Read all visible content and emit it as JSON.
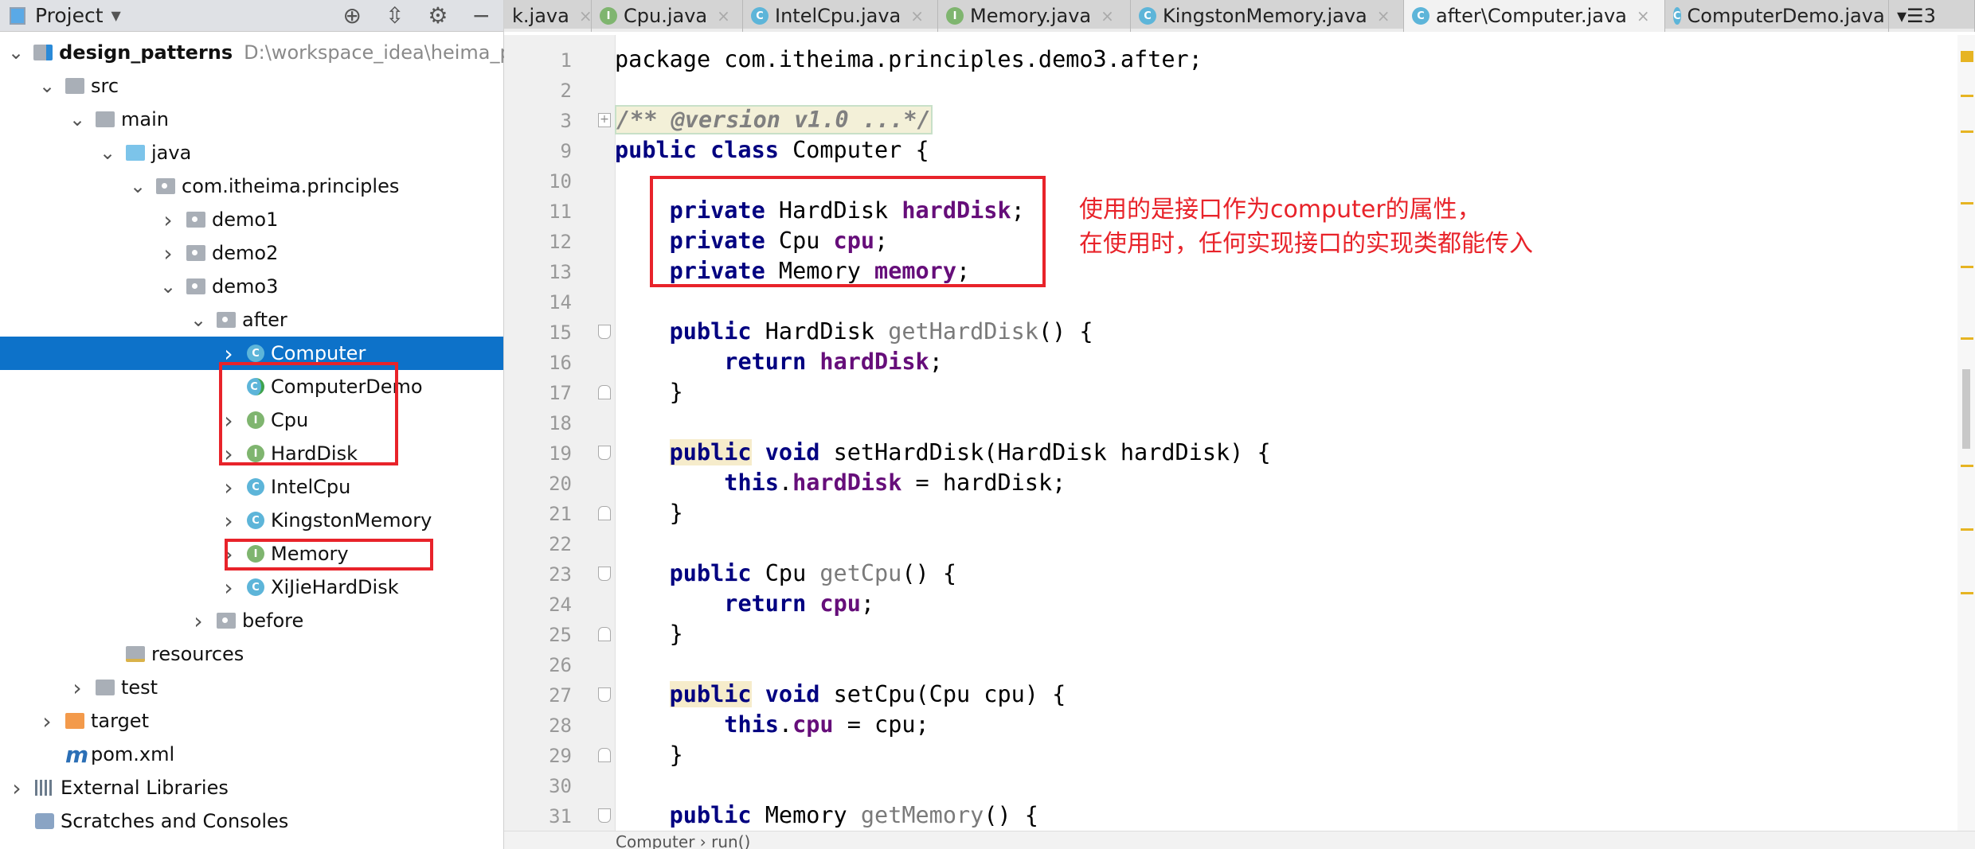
{
  "project_panel": {
    "title": "Project",
    "tree": [
      {
        "label": "design_patterns",
        "hint": "D:\\workspace_idea\\heima_pat",
        "level": 0,
        "icon": "module-folder",
        "expanded": true,
        "bold": true
      },
      {
        "label": "src",
        "level": 1,
        "icon": "folder",
        "expanded": true
      },
      {
        "label": "main",
        "level": 2,
        "icon": "folder",
        "expanded": true
      },
      {
        "label": "java",
        "level": 3,
        "icon": "source-folder",
        "expanded": true
      },
      {
        "label": "com.itheima.principles",
        "level": 4,
        "icon": "package",
        "expanded": true
      },
      {
        "label": "demo1",
        "level": 5,
        "icon": "package",
        "expanded": false
      },
      {
        "label": "demo2",
        "level": 5,
        "icon": "package",
        "expanded": false
      },
      {
        "label": "demo3",
        "level": 5,
        "icon": "package",
        "expanded": true
      },
      {
        "label": "after",
        "level": 6,
        "icon": "package",
        "expanded": true
      },
      {
        "label": "Computer",
        "level": 7,
        "icon": "class",
        "expanded": false,
        "selected": true
      },
      {
        "label": "ComputerDemo",
        "level": 7,
        "icon": "class-runnable"
      },
      {
        "label": "Cpu",
        "level": 7,
        "icon": "interface",
        "expanded": false
      },
      {
        "label": "HardDisk",
        "level": 7,
        "icon": "interface",
        "expanded": false
      },
      {
        "label": "IntelCpu",
        "level": 7,
        "icon": "class",
        "expanded": false
      },
      {
        "label": "KingstonMemory",
        "level": 7,
        "icon": "class",
        "expanded": false
      },
      {
        "label": "Memory",
        "level": 7,
        "icon": "interface",
        "expanded": false
      },
      {
        "label": "XiJieHardDisk",
        "level": 7,
        "icon": "class",
        "expanded": false
      },
      {
        "label": "before",
        "level": 6,
        "icon": "package",
        "expanded": false
      },
      {
        "label": "resources",
        "level": 3,
        "icon": "resources-folder"
      },
      {
        "label": "test",
        "level": 2,
        "icon": "folder",
        "expanded": false
      },
      {
        "label": "target",
        "level": 1,
        "icon": "excluded-folder",
        "expanded": false
      },
      {
        "label": "pom.xml",
        "level": 1,
        "icon": "maven-file"
      },
      {
        "label": "External Libraries",
        "level": 0,
        "icon": "library",
        "expanded": false
      },
      {
        "label": "Scratches and Consoles",
        "level": 0,
        "icon": "scratches"
      }
    ]
  },
  "tabs": [
    {
      "label": "k.java",
      "icon": "none"
    },
    {
      "label": "Cpu.java",
      "icon": "interface"
    },
    {
      "label": "IntelCpu.java",
      "icon": "class"
    },
    {
      "label": "Memory.java",
      "icon": "interface"
    },
    {
      "label": "KingstonMemory.java",
      "icon": "class"
    },
    {
      "label": "after\\Computer.java",
      "icon": "class",
      "active": true
    },
    {
      "label": "ComputerDemo.java",
      "icon": "class-runnable"
    }
  ],
  "tabs_overflow": "3",
  "code": [
    {
      "n": "1",
      "t": [
        [
          "package com.itheima.principles.demo3.after;",
          ""
        ]
      ]
    },
    {
      "n": "2",
      "t": []
    },
    {
      "n": "3",
      "fold": "plus",
      "t": [
        [
          "/** @version v1.0 ...*/",
          "cmt"
        ]
      ]
    },
    {
      "n": "9",
      "t": [
        [
          "public class",
          "kw"
        ],
        [
          " Computer {",
          ""
        ]
      ]
    },
    {
      "n": "10",
      "t": []
    },
    {
      "n": "11",
      "t": [
        [
          "    ",
          ""
        ],
        [
          "private",
          "kw"
        ],
        [
          " HardDisk ",
          ""
        ],
        [
          "hardDisk",
          "fld"
        ],
        [
          ";",
          ""
        ]
      ]
    },
    {
      "n": "12",
      "t": [
        [
          "    ",
          ""
        ],
        [
          "private",
          "kw"
        ],
        [
          " Cpu ",
          ""
        ],
        [
          "cpu",
          "fld"
        ],
        [
          ";",
          ""
        ]
      ]
    },
    {
      "n": "13",
      "t": [
        [
          "    ",
          ""
        ],
        [
          "private",
          "kw"
        ],
        [
          " Memory ",
          ""
        ],
        [
          "memory",
          "fld"
        ],
        [
          ";",
          ""
        ]
      ]
    },
    {
      "n": "14",
      "t": []
    },
    {
      "n": "15",
      "fold": "open",
      "t": [
        [
          "    ",
          ""
        ],
        [
          "public",
          "kw"
        ],
        [
          " HardDisk ",
          ""
        ],
        [
          "getHardDisk",
          "mth"
        ],
        [
          "() {",
          ""
        ]
      ]
    },
    {
      "n": "16",
      "t": [
        [
          "        ",
          ""
        ],
        [
          "return",
          "kw"
        ],
        [
          " ",
          ""
        ],
        [
          "hardDisk",
          "fld"
        ],
        [
          ";",
          ""
        ]
      ]
    },
    {
      "n": "17",
      "fold": "close",
      "t": [
        [
          "    }",
          ""
        ]
      ]
    },
    {
      "n": "18",
      "t": []
    },
    {
      "n": "19",
      "fold": "open",
      "t": [
        [
          "    ",
          ""
        ],
        [
          "public",
          "kw hl"
        ],
        [
          " ",
          ""
        ],
        [
          "void",
          "kw"
        ],
        [
          " setHardDisk(HardDisk hardDisk) {",
          ""
        ]
      ]
    },
    {
      "n": "20",
      "t": [
        [
          "        ",
          ""
        ],
        [
          "this",
          "kw"
        ],
        [
          ".",
          ""
        ],
        [
          "hardDisk",
          "fld"
        ],
        [
          " = hardDisk;",
          ""
        ]
      ]
    },
    {
      "n": "21",
      "fold": "close",
      "t": [
        [
          "    }",
          ""
        ]
      ]
    },
    {
      "n": "22",
      "t": []
    },
    {
      "n": "23",
      "fold": "open",
      "t": [
        [
          "    ",
          ""
        ],
        [
          "public",
          "kw"
        ],
        [
          " Cpu ",
          ""
        ],
        [
          "getCpu",
          "mth"
        ],
        [
          "() {",
          ""
        ]
      ]
    },
    {
      "n": "24",
      "t": [
        [
          "        ",
          ""
        ],
        [
          "return",
          "kw"
        ],
        [
          " ",
          ""
        ],
        [
          "cpu",
          "fld"
        ],
        [
          ";",
          ""
        ]
      ]
    },
    {
      "n": "25",
      "fold": "close",
      "t": [
        [
          "    }",
          ""
        ]
      ]
    },
    {
      "n": "26",
      "t": []
    },
    {
      "n": "27",
      "fold": "open",
      "t": [
        [
          "    ",
          ""
        ],
        [
          "public",
          "kw hl"
        ],
        [
          " ",
          ""
        ],
        [
          "void",
          "kw"
        ],
        [
          " setCpu(Cpu cpu) {",
          ""
        ]
      ]
    },
    {
      "n": "28",
      "t": [
        [
          "        ",
          ""
        ],
        [
          "this",
          "kw"
        ],
        [
          ".",
          ""
        ],
        [
          "cpu",
          "fld"
        ],
        [
          " = cpu;",
          ""
        ]
      ]
    },
    {
      "n": "29",
      "fold": "close",
      "t": [
        [
          "    }",
          ""
        ]
      ]
    },
    {
      "n": "30",
      "t": []
    },
    {
      "n": "31",
      "fold": "open",
      "t": [
        [
          "    ",
          ""
        ],
        [
          "public",
          "kw"
        ],
        [
          " Memory ",
          ""
        ],
        [
          "getMemory",
          "mth"
        ],
        [
          "() {",
          ""
        ]
      ]
    }
  ],
  "annotation": {
    "line1": "使用的是接口作为computer的属性，",
    "line2": "在使用时，任何实现接口的实现类都能传入",
    "color": "#e8232a"
  },
  "breadcrumb": "Computer  ›  run()",
  "colors": {
    "selection": "#0d72c9",
    "keyword": "#000080",
    "field": "#660e7a",
    "annotation_red": "#e8232a"
  }
}
